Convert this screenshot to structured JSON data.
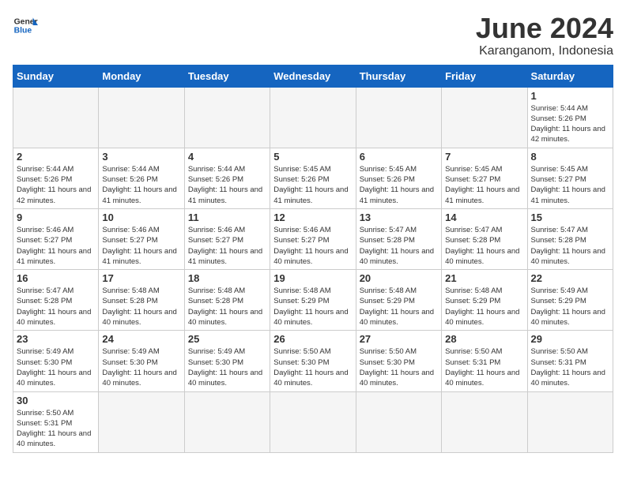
{
  "logo": {
    "line1": "General",
    "line2": "Blue"
  },
  "title": "June 2024",
  "subtitle": "Karanganom, Indonesia",
  "weekdays": [
    "Sunday",
    "Monday",
    "Tuesday",
    "Wednesday",
    "Thursday",
    "Friday",
    "Saturday"
  ],
  "days": [
    {
      "num": "",
      "info": ""
    },
    {
      "num": "",
      "info": ""
    },
    {
      "num": "",
      "info": ""
    },
    {
      "num": "",
      "info": ""
    },
    {
      "num": "",
      "info": ""
    },
    {
      "num": "",
      "info": ""
    },
    {
      "num": "1",
      "info": "Sunrise: 5:44 AM\nSunset: 5:26 PM\nDaylight: 11 hours\nand 42 minutes."
    }
  ],
  "week2": [
    {
      "num": "2",
      "info": "Sunrise: 5:44 AM\nSunset: 5:26 PM\nDaylight: 11 hours\nand 42 minutes."
    },
    {
      "num": "3",
      "info": "Sunrise: 5:44 AM\nSunset: 5:26 PM\nDaylight: 11 hours\nand 41 minutes."
    },
    {
      "num": "4",
      "info": "Sunrise: 5:44 AM\nSunset: 5:26 PM\nDaylight: 11 hours\nand 41 minutes."
    },
    {
      "num": "5",
      "info": "Sunrise: 5:45 AM\nSunset: 5:26 PM\nDaylight: 11 hours\nand 41 minutes."
    },
    {
      "num": "6",
      "info": "Sunrise: 5:45 AM\nSunset: 5:26 PM\nDaylight: 11 hours\nand 41 minutes."
    },
    {
      "num": "7",
      "info": "Sunrise: 5:45 AM\nSunset: 5:27 PM\nDaylight: 11 hours\nand 41 minutes."
    },
    {
      "num": "8",
      "info": "Sunrise: 5:45 AM\nSunset: 5:27 PM\nDaylight: 11 hours\nand 41 minutes."
    }
  ],
  "week3": [
    {
      "num": "9",
      "info": "Sunrise: 5:46 AM\nSunset: 5:27 PM\nDaylight: 11 hours\nand 41 minutes."
    },
    {
      "num": "10",
      "info": "Sunrise: 5:46 AM\nSunset: 5:27 PM\nDaylight: 11 hours\nand 41 minutes."
    },
    {
      "num": "11",
      "info": "Sunrise: 5:46 AM\nSunset: 5:27 PM\nDaylight: 11 hours\nand 41 minutes."
    },
    {
      "num": "12",
      "info": "Sunrise: 5:46 AM\nSunset: 5:27 PM\nDaylight: 11 hours\nand 40 minutes."
    },
    {
      "num": "13",
      "info": "Sunrise: 5:47 AM\nSunset: 5:28 PM\nDaylight: 11 hours\nand 40 minutes."
    },
    {
      "num": "14",
      "info": "Sunrise: 5:47 AM\nSunset: 5:28 PM\nDaylight: 11 hours\nand 40 minutes."
    },
    {
      "num": "15",
      "info": "Sunrise: 5:47 AM\nSunset: 5:28 PM\nDaylight: 11 hours\nand 40 minutes."
    }
  ],
  "week4": [
    {
      "num": "16",
      "info": "Sunrise: 5:47 AM\nSunset: 5:28 PM\nDaylight: 11 hours\nand 40 minutes."
    },
    {
      "num": "17",
      "info": "Sunrise: 5:48 AM\nSunset: 5:28 PM\nDaylight: 11 hours\nand 40 minutes."
    },
    {
      "num": "18",
      "info": "Sunrise: 5:48 AM\nSunset: 5:28 PM\nDaylight: 11 hours\nand 40 minutes."
    },
    {
      "num": "19",
      "info": "Sunrise: 5:48 AM\nSunset: 5:29 PM\nDaylight: 11 hours\nand 40 minutes."
    },
    {
      "num": "20",
      "info": "Sunrise: 5:48 AM\nSunset: 5:29 PM\nDaylight: 11 hours\nand 40 minutes."
    },
    {
      "num": "21",
      "info": "Sunrise: 5:48 AM\nSunset: 5:29 PM\nDaylight: 11 hours\nand 40 minutes."
    },
    {
      "num": "22",
      "info": "Sunrise: 5:49 AM\nSunset: 5:29 PM\nDaylight: 11 hours\nand 40 minutes."
    }
  ],
  "week5": [
    {
      "num": "23",
      "info": "Sunrise: 5:49 AM\nSunset: 5:30 PM\nDaylight: 11 hours\nand 40 minutes."
    },
    {
      "num": "24",
      "info": "Sunrise: 5:49 AM\nSunset: 5:30 PM\nDaylight: 11 hours\nand 40 minutes."
    },
    {
      "num": "25",
      "info": "Sunrise: 5:49 AM\nSunset: 5:30 PM\nDaylight: 11 hours\nand 40 minutes."
    },
    {
      "num": "26",
      "info": "Sunrise: 5:50 AM\nSunset: 5:30 PM\nDaylight: 11 hours\nand 40 minutes."
    },
    {
      "num": "27",
      "info": "Sunrise: 5:50 AM\nSunset: 5:30 PM\nDaylight: 11 hours\nand 40 minutes."
    },
    {
      "num": "28",
      "info": "Sunrise: 5:50 AM\nSunset: 5:31 PM\nDaylight: 11 hours\nand 40 minutes."
    },
    {
      "num": "29",
      "info": "Sunrise: 5:50 AM\nSunset: 5:31 PM\nDaylight: 11 hours\nand 40 minutes."
    }
  ],
  "week6": [
    {
      "num": "30",
      "info": "Sunrise: 5:50 AM\nSunset: 5:31 PM\nDaylight: 11 hours\nand 40 minutes."
    },
    {
      "num": "",
      "info": ""
    },
    {
      "num": "",
      "info": ""
    },
    {
      "num": "",
      "info": ""
    },
    {
      "num": "",
      "info": ""
    },
    {
      "num": "",
      "info": ""
    },
    {
      "num": "",
      "info": ""
    }
  ],
  "colors": {
    "header_bg": "#1565c0",
    "border": "#cccccc",
    "empty_bg": "#f5f5f5"
  }
}
